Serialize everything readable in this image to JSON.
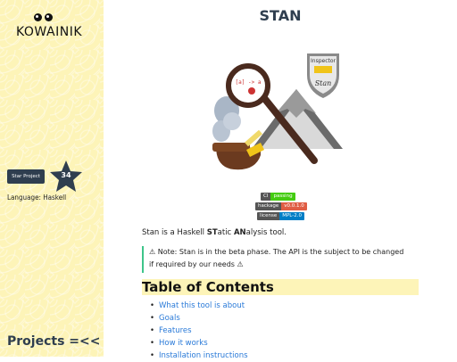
{
  "sidebar": {
    "logo_text": "KOWAINIK",
    "star_button_label": "Star Project",
    "star_count": "34",
    "language": "Language: Haskell",
    "projects_label": "Projects =<<"
  },
  "main": {
    "title": "STAN",
    "badges": [
      {
        "label": "CI",
        "value": "passing",
        "color": "#44cc11"
      },
      {
        "label": "hackage",
        "value": "v0.0.1.0",
        "color": "#e05d44"
      },
      {
        "label": "license",
        "value": "MPL-2.0",
        "color": "#007ec6"
      }
    ],
    "intro_prefix": "Stan is a Haskell ",
    "intro_st": "ST",
    "intro_mid": "atic ",
    "intro_an": "AN",
    "intro_suffix": "alysis tool.",
    "note_line1": "⚠ Note: Stan is in the beta phase. The API is the subject to be changed",
    "note_line2": "if required by our needs ⚠",
    "toc_title": "Table of Contents",
    "toc_items": [
      "What this tool is about",
      "Goals",
      "Features",
      "How it works",
      "Installation instructions"
    ],
    "hero_badge_top": "Inspector",
    "hero_badge_name": "Stan",
    "hero_lens_text": "[a] -> a"
  }
}
